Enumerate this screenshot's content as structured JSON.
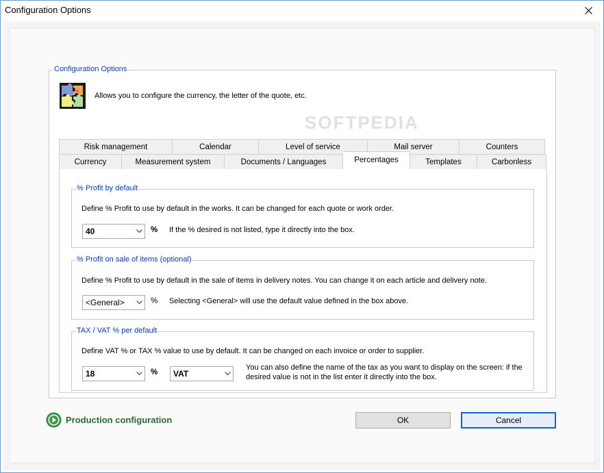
{
  "window": {
    "title": "Configuration Options"
  },
  "main_group": {
    "legend": "Configuration Options",
    "description": "Allows you to configure the currency, the letter of the quote, etc."
  },
  "tabs_top_row": [
    {
      "label": "Risk management"
    },
    {
      "label": "Calendar"
    },
    {
      "label": "Level of service"
    },
    {
      "label": "Mail server"
    },
    {
      "label": "Counters"
    }
  ],
  "tabs_bottom_row": [
    {
      "label": "Currency"
    },
    {
      "label": "Measurement system"
    },
    {
      "label": "Documents / Languages"
    },
    {
      "label": "Percentages",
      "active": true
    },
    {
      "label": "Templates"
    },
    {
      "label": "Carbonless"
    }
  ],
  "profit_default": {
    "legend": "% Profit by default",
    "description": "Define % Profit to use by default in the works. It can be changed for each quote or work order.",
    "value": "40",
    "unit": "%",
    "hint": "If the % desired is not listed, type it directly into the box."
  },
  "profit_sale": {
    "legend": "% Profit on sale of items (optional)",
    "description": "Define % Profit to use by default in the sale of items in delivery notes. You can change it on each article and delivery note.",
    "value": "<General>",
    "unit": "%",
    "hint": "Selecting <General> will use the default value defined in the box above."
  },
  "tax": {
    "legend": "TAX / VAT % per default",
    "description": "Define VAT % or TAX % value to use by default. It can be changed on each invoice or order to supplier.",
    "value": "18",
    "unit": "%",
    "tax_name": "VAT",
    "hint": "You can also define the name of the tax as you want to display on the screen: if the desired value is not in the list enter it directly into the box."
  },
  "footer": {
    "production_label": "Production configuration",
    "ok_label": "OK",
    "cancel_label": "Cancel"
  },
  "watermark": "SOFTPEDIA",
  "colors": {
    "legend_blue": "#0a3aa8",
    "production_green": "#2d6a34",
    "default_button_border": "#0a63c9"
  }
}
